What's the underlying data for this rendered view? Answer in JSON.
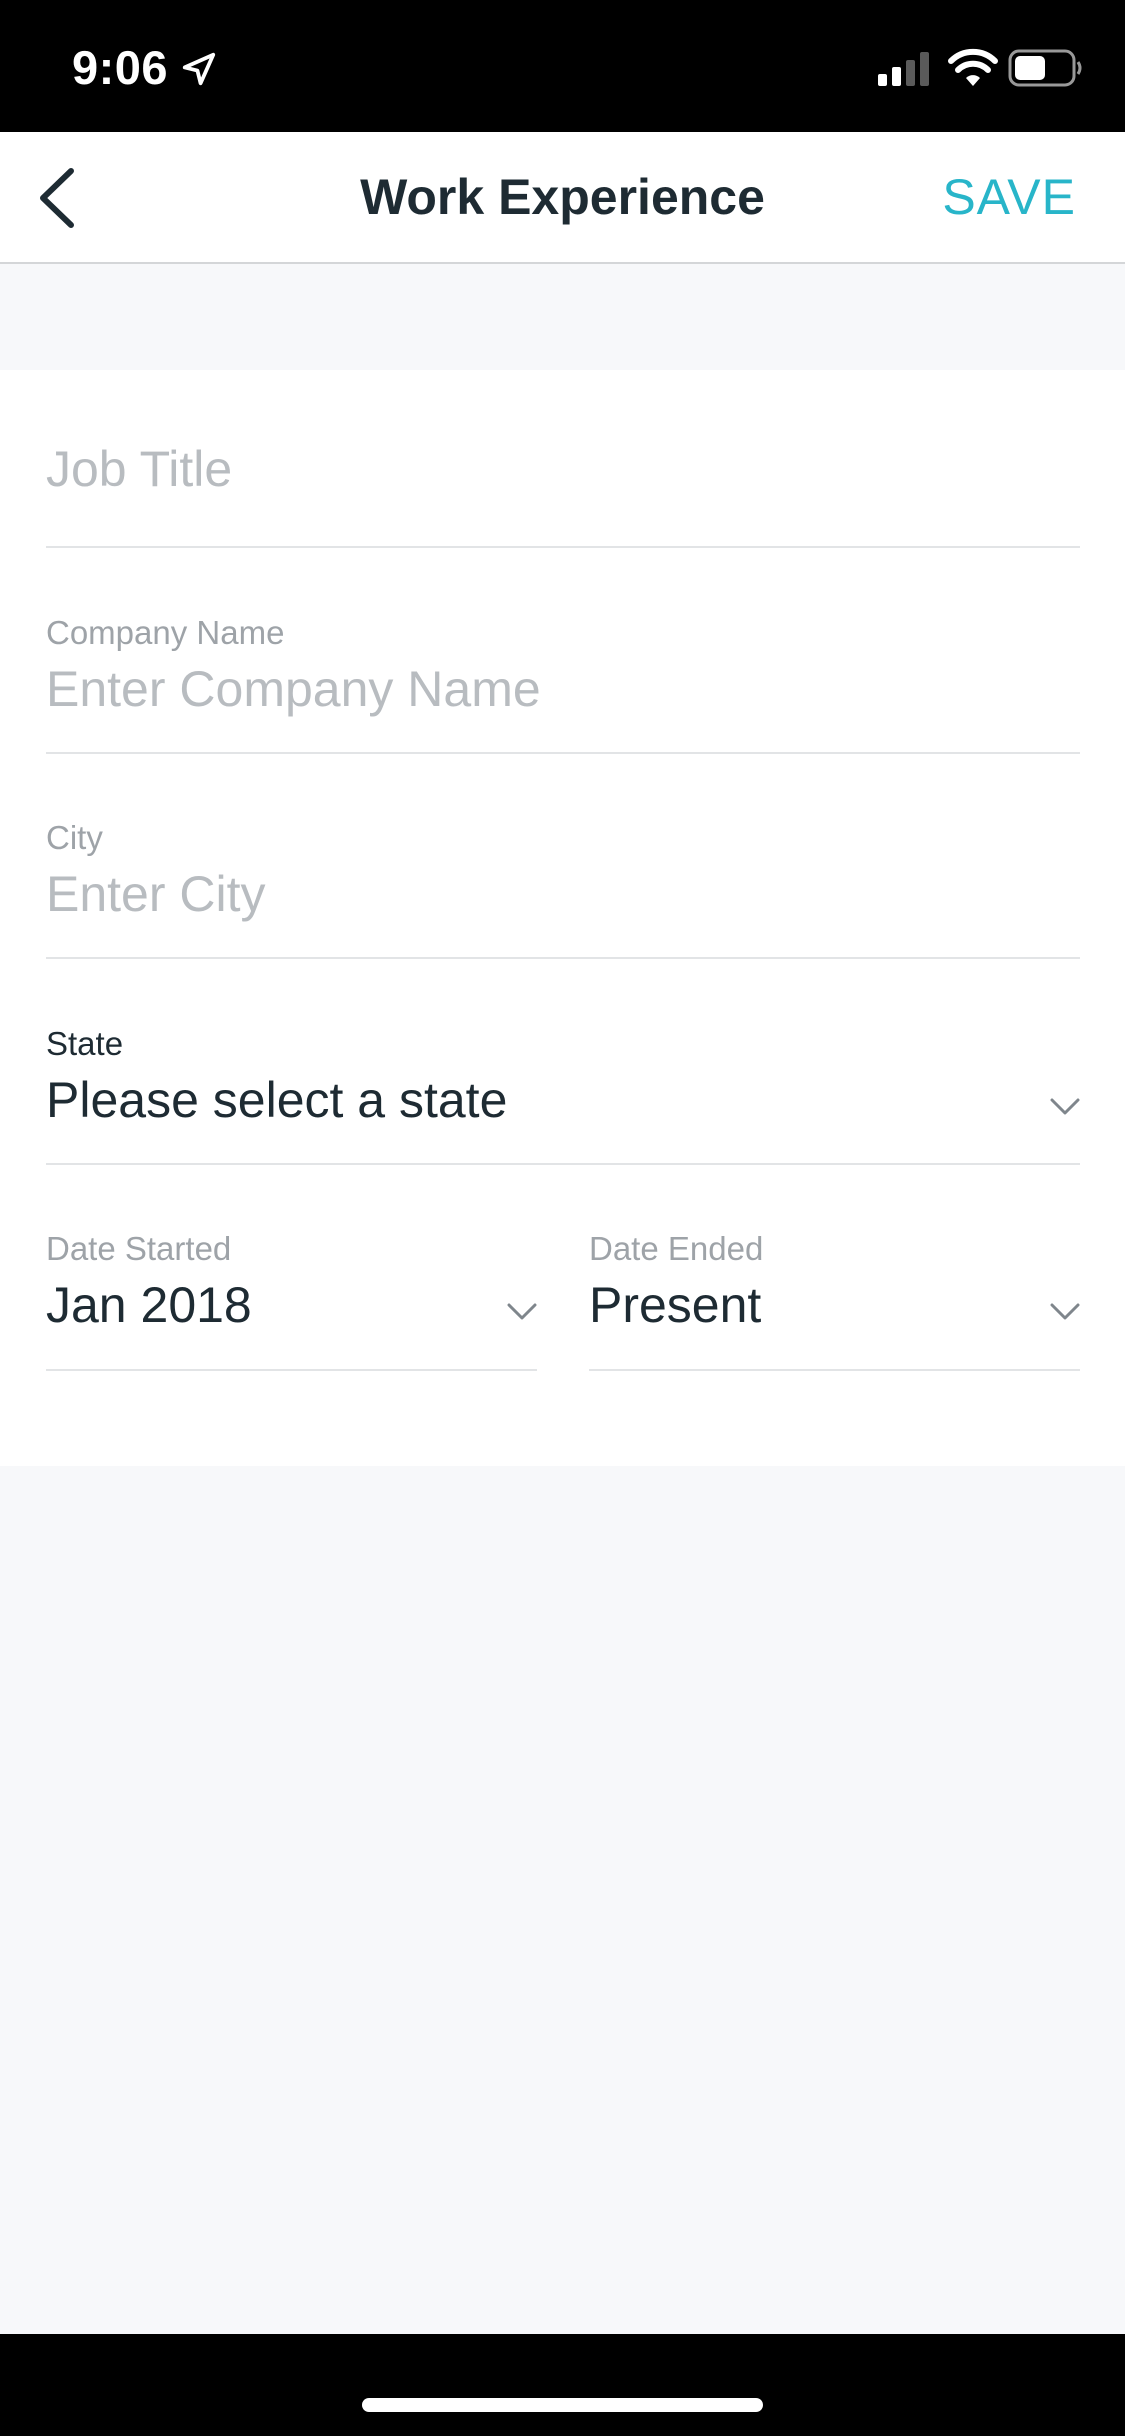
{
  "status_bar": {
    "time": "9:06"
  },
  "nav": {
    "title": "Work Experience",
    "save_label": "SAVE"
  },
  "form": {
    "job_title": {
      "placeholder": "Job Title"
    },
    "company_name": {
      "label": "Company Name",
      "placeholder": "Enter Company Name"
    },
    "city": {
      "label": "City",
      "placeholder": "Enter City"
    },
    "state": {
      "label": "State",
      "value": "Please select a state"
    },
    "date_started": {
      "label": "Date Started",
      "value": "Jan 2018"
    },
    "date_ended": {
      "label": "Date Ended",
      "value": "Present"
    }
  },
  "colors": {
    "accent": "#28b5c9",
    "text_dark": "#1e2b33",
    "placeholder": "#b8bcc0",
    "background": "#f7f8fa"
  },
  "icons": [
    "back-chevron-icon",
    "chevron-down-icon",
    "location-arrow-icon",
    "signal-icon",
    "wifi-icon",
    "battery-icon"
  ]
}
